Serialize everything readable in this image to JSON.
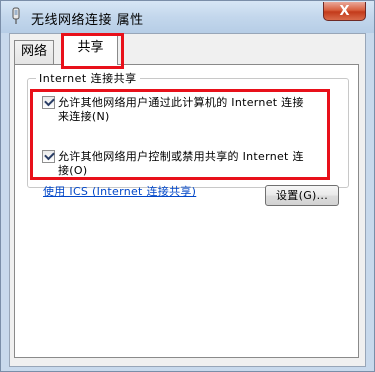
{
  "window": {
    "title": "无线网络连接 属性",
    "close_symbol": "X",
    "icon": "network-adapter-icon"
  },
  "tabs": [
    {
      "label": "网络",
      "active": false
    },
    {
      "label": "共享",
      "active": true
    }
  ],
  "sharing": {
    "group_title": "Internet 连接共享",
    "option1": {
      "line1": "允许其他网络用户通过此计算机的 Internet 连接",
      "line2": "来连接(N)",
      "checked": true
    },
    "option2": {
      "line1": "允许其他网络用户控制或禁用共享的 Internet 连",
      "line2": "接(O)",
      "checked": true
    },
    "ics_link": "使用 ICS (Internet 连接共享)",
    "settings_button": "设置(G)..."
  },
  "colors": {
    "highlight": "#e8101a",
    "link": "#0046c8"
  }
}
